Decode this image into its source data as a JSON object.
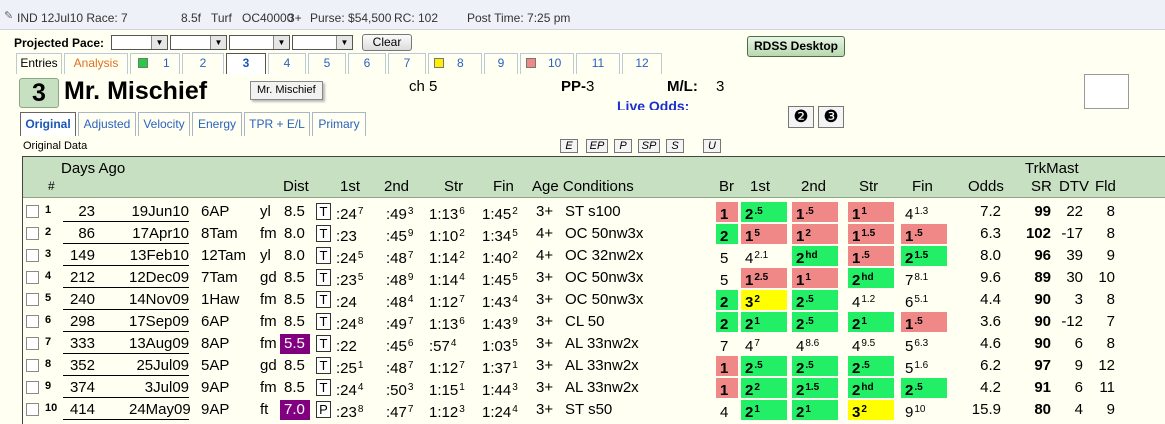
{
  "titlebar": {
    "track_race": "IND 12Jul10 Race: 7",
    "distance": "8.5f",
    "surface": "Turf",
    "race_class": "OC40000",
    "age": "3+",
    "purse": "Purse: $54,500",
    "rc": "RC: 102",
    "post_time": "Post Time: 7:25 pm"
  },
  "pace": {
    "label": "Projected Pace:",
    "clear_label": "Clear",
    "rdss_label": "RDSS Desktop"
  },
  "tabs": [
    {
      "label": "Entries"
    },
    {
      "label": "Analysis"
    },
    {
      "label": "1",
      "swatch": "#22cc44"
    },
    {
      "label": "2"
    },
    {
      "label": "3"
    },
    {
      "label": "4"
    },
    {
      "label": "5"
    },
    {
      "label": "6"
    },
    {
      "label": "7"
    },
    {
      "label": "8",
      "swatch": "#ffee00"
    },
    {
      "label": "9"
    },
    {
      "label": "10",
      "swatch": "#f08888"
    },
    {
      "label": "11"
    },
    {
      "label": "12"
    }
  ],
  "horse": {
    "number": "3",
    "name": "Mr. Mischief",
    "tooltip": "Mr. Mischief",
    "color_age": "ch 5",
    "pp_label": "PP-",
    "pp_value": "3",
    "ml_label": "M/L:",
    "ml_value": "3",
    "live_odds_label": "Live Odds:",
    "btn_a": "❷",
    "btn_b": "❸"
  },
  "subtabs": [
    "Original",
    "Adjusted",
    "Velocity",
    "Energy",
    "TPR + E/L",
    "Primary"
  ],
  "original_data_label": "Original Data",
  "mini_buttons": [
    "E",
    "EP",
    "P",
    "SP",
    "S",
    "U"
  ],
  "headers": {
    "days_ago": "Days Ago",
    "num": "#",
    "dist": "Dist",
    "first": "1st",
    "second": "2nd",
    "str": "Str",
    "fin": "Fin",
    "age_cond": "Age Conditions",
    "br": "Br",
    "c1st": "1st",
    "c2nd": "2nd",
    "cstr": "Str",
    "cfin": "Fin",
    "odds": "Odds",
    "trkmast": "TrkMast",
    "sr": "SR",
    "dtv": "DTV",
    "fld": "Fld"
  },
  "rows": [
    {
      "n": "1",
      "days": "23",
      "date": "19Jun10",
      "track": "6AP",
      "cond": "yl",
      "dist": "8.5",
      "surf": "T",
      "f1": ":24",
      "f1s": "7",
      "f2": ":49",
      "f2s": "3",
      "fs": "1:13",
      "fss": "6",
      "ff": "1:45",
      "ffs": "2",
      "age": "3+",
      "conds": "ST s100",
      "br": "1",
      "brc": "red",
      "p1": "2",
      ".p1s": ".5",
      "p1c": "grn",
      "p2": "1",
      "p2s": ".5",
      "p2c": "red",
      "ps": "1",
      "pss": "1",
      "psc": "red",
      "pf": "4",
      "pfs": "1.3",
      "pfc": "",
      "odds": "7.2",
      "sr": "99",
      "dtv": "22",
      "fld": "8"
    },
    {
      "n": "2",
      "days": "86",
      "date": "17Apr10",
      "track": "8Tam",
      "cond": "fm",
      "dist": "8.0",
      "surf": "T",
      "f1": ":23",
      "f1s": "",
      "f2": ":45",
      "f2s": "9",
      "fs": "1:10",
      "fss": "2",
      "ff": "1:34",
      "ffs": "5",
      "age": "4+",
      "conds": "OC 50nw3x",
      "br": "2",
      "brc": "grn",
      "p1": "1",
      "p1s": "5",
      "p1c": "red",
      "p2": "1",
      "p2s": "2",
      "p2c": "red",
      "ps": "1",
      "pss": "1.5",
      "psc": "red",
      "pf": "1",
      "pfs": ".5",
      "pfc": "red",
      "odds": "6.3",
      "sr": "102",
      "dtv": "-17",
      "fld": "8"
    },
    {
      "n": "3",
      "days": "149",
      "date": "13Feb10",
      "track": "12Tam",
      "cond": "yl",
      "dist": "8.0",
      "surf": "T",
      "f1": ":24",
      "f1s": "5",
      "f2": ":48",
      "f2s": "7",
      "fs": "1:14",
      "fss": "2",
      "ff": "1:40",
      "ffs": "2",
      "age": "4+",
      "conds": "OC 32nw2x",
      "br": "5",
      "brc": "",
      "p1": "4",
      "p1s": "2.1",
      "p1c": "",
      "p2": "2",
      "p2s": "hd",
      "p2c": "grn",
      "ps": "1",
      "pss": ".5",
      "psc": "red",
      "pf": "2",
      "pfs": "1.5",
      "pfc": "grn",
      "odds": "8.0",
      "sr": "96",
      "dtv": "39",
      "fld": "9"
    },
    {
      "n": "4",
      "days": "212",
      "date": "12Dec09",
      "track": "7Tam",
      "cond": "gd",
      "dist": "8.5",
      "surf": "T",
      "f1": ":23",
      "f1s": "5",
      "f2": ":48",
      "f2s": "9",
      "fs": "1:14",
      "fss": "4",
      "ff": "1:45",
      "ffs": "5",
      "age": "3+",
      "conds": "OC 50nw3x",
      "br": "5",
      "brc": "",
      "p1": "1",
      "p1s": "2.5",
      "p1c": "red",
      "p2": "1",
      "p2s": "1",
      "p2c": "red",
      "ps": "2",
      "pss": "hd",
      "psc": "grn",
      "pf": "7",
      "pfs": "8.1",
      "pfc": "",
      "odds": "9.6",
      "sr": "89",
      "dtv": "30",
      "fld": "10"
    },
    {
      "n": "5",
      "days": "240",
      "date": "14Nov09",
      "track": "1Haw",
      "cond": "fm",
      "dist": "8.5",
      "surf": "T",
      "f1": ":24",
      "f1s": "",
      "f2": ":48",
      "f2s": "4",
      "fs": "1:12",
      "fss": "7",
      "ff": "1:43",
      "ffs": "4",
      "age": "3+",
      "conds": "OC 50nw3x",
      "br": "2",
      "brc": "grn",
      "p1": "3",
      "p1s": "2",
      "p1c": "yel",
      "p2": "2",
      "p2s": ".5",
      "p2c": "grn",
      "ps": "4",
      "pss": "1.2",
      "psc": "",
      "pf": "6",
      "pfs": "5.1",
      "pfc": "",
      "odds": "4.4",
      "sr": "90",
      "dtv": "3",
      "fld": "8"
    },
    {
      "n": "6",
      "days": "298",
      "date": "17Sep09",
      "track": "6AP",
      "cond": "fm",
      "dist": "8.5",
      "surf": "T",
      "f1": ":24",
      "f1s": "8",
      "f2": ":49",
      "f2s": "7",
      "fs": "1:13",
      "fss": "6",
      "ff": "1:43",
      "ffs": "9",
      "age": "3+",
      "conds": "CL 50",
      "br": "2",
      "brc": "grn",
      "p1": "2",
      "p1s": "1",
      "p1c": "grn",
      "p2": "2",
      "p2s": ".5",
      "p2c": "grn",
      "ps": "2",
      "pss": "1",
      "psc": "grn",
      "pf": "1",
      "pfs": ".5",
      "pfc": "red",
      "odds": "3.6",
      "sr": "90",
      "dtv": "-12",
      "fld": "7"
    },
    {
      "n": "7",
      "days": "333",
      "date": "13Aug09",
      "track": "8AP",
      "cond": "fm",
      "dist": "5.5",
      "surf": "T",
      "f1": ":22",
      "f1s": "",
      "f2": ":45",
      "f2s": "6",
      "fs": ":57",
      "fss": "4",
      "ff": "1:03",
      "ffs": "5",
      "age": "3+",
      "conds": "AL 33nw2x",
      "br": "7",
      "brc": "",
      "p1": "4",
      "p1s": "7",
      "p1c": "",
      "p2": "4",
      "p2s": "8.6",
      "p2c": "",
      "ps": "4",
      "pss": "9.5",
      "psc": "",
      "pf": "5",
      "pfs": "6.3",
      "pfc": "",
      "odds": "4.6",
      "sr": "90",
      "dtv": "6",
      "fld": "8",
      "distc": "pur"
    },
    {
      "n": "8",
      "days": "352",
      "date": "25Jul09",
      "track": "5AP",
      "cond": "gd",
      "dist": "8.5",
      "surf": "T",
      "f1": ":25",
      "f1s": "1",
      "f2": ":48",
      "f2s": "7",
      "fs": "1:12",
      "fss": "7",
      "ff": "1:37",
      "ffs": "1",
      "age": "3+",
      "conds": "AL 33nw2x",
      "br": "1",
      "brc": "red",
      "p1": "2",
      "p1s": ".5",
      "p1c": "grn",
      "p2": "2",
      "p2s": ".5",
      "p2c": "grn",
      "ps": "2",
      "pss": ".5",
      "psc": "grn",
      "pf": "5",
      "pfs": "1.6",
      "pfc": "",
      "odds": "6.2",
      "sr": "97",
      "dtv": "9",
      "fld": "12"
    },
    {
      "n": "9",
      "days": "374",
      "date": "3Jul09",
      "track": "9AP",
      "cond": "fm",
      "dist": "8.5",
      "surf": "T",
      "f1": ":24",
      "f1s": "4",
      "f2": ":50",
      "f2s": "3",
      "fs": "1:15",
      "fss": "1",
      "ff": "1:44",
      "ffs": "3",
      "age": "3+",
      "conds": "AL 33nw2x",
      "br": "1",
      "brc": "red",
      "p1": "2",
      "p1s": "2",
      "p1c": "grn",
      "p2": "2",
      "p2s": "1.5",
      "p2c": "grn",
      "ps": "2",
      "pss": "hd",
      "psc": "grn",
      "pf": "2",
      "pfs": ".5",
      "pfc": "grn",
      "odds": "4.2",
      "sr": "91",
      "dtv": "6",
      "fld": "11"
    },
    {
      "n": "10",
      "days": "414",
      "date": "24May09",
      "track": "9AP",
      "cond": "ft",
      "dist": "7.0",
      "surf": "P",
      "f1": ":23",
      "f1s": "8",
      "f2": ":47",
      "f2s": "7",
      "fs": "1:12",
      "fss": "3",
      "ff": "1:24",
      "ffs": "4",
      "age": "3+",
      "conds": "ST s50",
      "br": "4",
      "brc": "",
      "p1": "2",
      "p1s": "1",
      "p1c": "grn",
      "p2": "2",
      "p2s": "1",
      "p2c": "grn",
      "ps": "3",
      "pss": "2",
      "psc": "yel",
      "pf": "9",
      "pfs": "10",
      "pfc": "",
      "odds": "15.9",
      "sr": "80",
      "dtv": "4",
      "fld": "9",
      "distc": "pur"
    }
  ]
}
